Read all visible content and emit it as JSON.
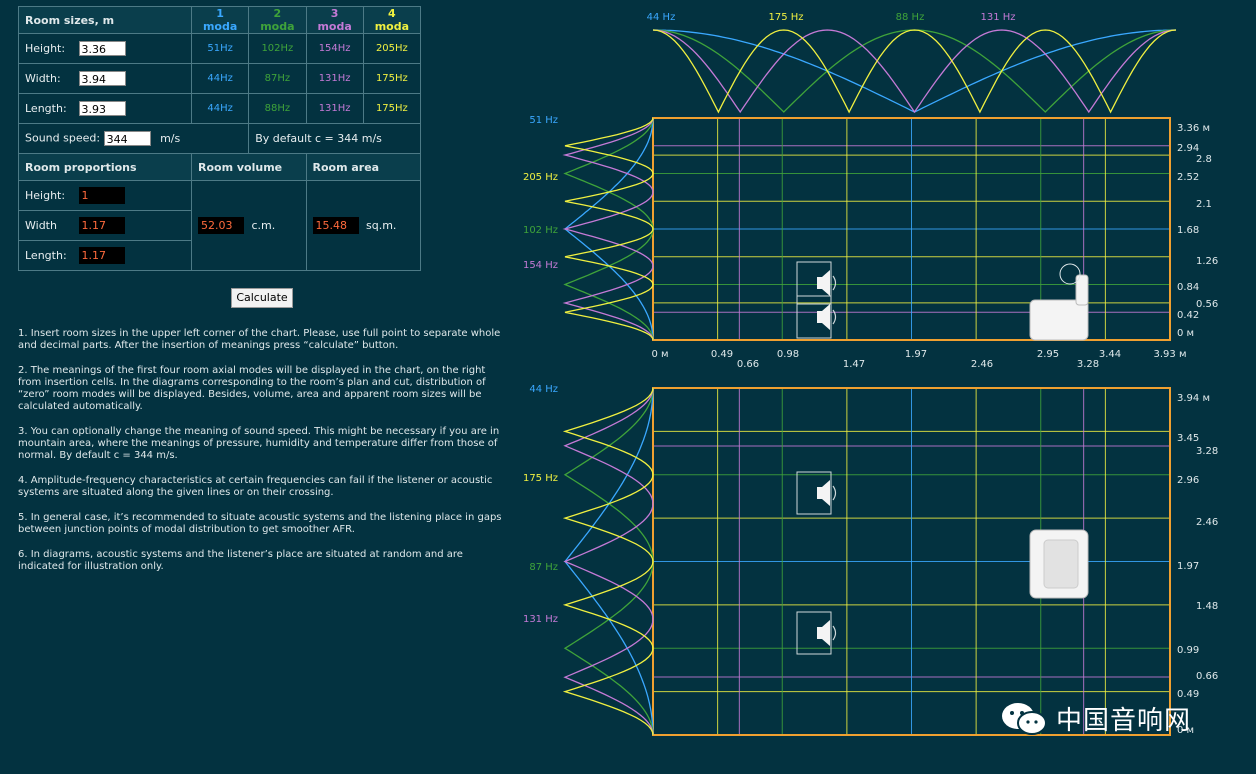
{
  "table": {
    "title": "Room sizes, m",
    "mode_headers": [
      "1 moda",
      "2 moda",
      "3 moda",
      "4 moda"
    ],
    "rows": [
      {
        "label": "Height:",
        "value": "3.36",
        "modes": [
          "51Hz",
          "102Hz",
          "154Hz",
          "205Hz"
        ]
      },
      {
        "label": "Width:",
        "value": "3.94",
        "modes": [
          "44Hz",
          "87Hz",
          "131Hz",
          "175Hz"
        ]
      },
      {
        "label": "Length:",
        "value": "3.93",
        "modes": [
          "44Hz",
          "88Hz",
          "131Hz",
          "175Hz"
        ]
      }
    ],
    "sound_speed_label": "Sound speed:",
    "sound_speed_value": "344",
    "sound_speed_unit": "m/s",
    "default_text": "By default c = 344 m/s",
    "proportions_header": "Room proportions",
    "volume_header": "Room volume",
    "area_header": "Room area",
    "proportions": [
      {
        "label": "Height:",
        "value": "1"
      },
      {
        "label": "Width",
        "value": "1.17"
      },
      {
        "label": "Length:",
        "value": "1.17"
      }
    ],
    "volume_value": "52.03",
    "volume_unit": "c.m.",
    "area_value": "15.48",
    "area_unit": "sq.m."
  },
  "calculate_label": "Calculate",
  "notes": [
    "1. Insert room sizes in the upper left corner of the chart. Please, use full point to separate whole and decimal parts. After the insertion of meanings press “calculate” button.",
    "2. The meanings of the first four room axial modes will be displayed in the chart, on the right from insertion cells. In the diagrams corresponding to the room’s plan and cut, distribution of “zero” room modes will be displayed. Besides, volume, area and apparent room sizes will be calculated automatically.",
    "3. You can optionally change the meaning of sound speed. This might be necessary if you are in mountain area, where the meanings of pressure, humidity and temperature differ from those of normal. By default c = 344 m/s.",
    "4. Amplitude-frequency characteristics at certain frequencies can fail if the listener or acoustic systems are situated along the given lines or on their crossing.",
    "5. In general case, it’s recommended to situate acoustic systems and the listening place in gaps between junction points of modal distribution to get smoother AFR.",
    "6. In diagrams, acoustic systems and the listener’s place are situated at random and are indicated for illustration only."
  ],
  "colors": {
    "m1": "#3aa8ff",
    "m2": "#3fa33a",
    "m3": "#c47ad6",
    "m4": "#f0f040",
    "frame": "#f0a030"
  },
  "top_chart": {
    "x_labels": [
      "44 Hz",
      "175 Hz",
      "88 Hz",
      "131 Hz"
    ],
    "left_labels": [
      "51 Hz",
      "205 Hz",
      "102 Hz",
      "154 Hz"
    ],
    "right_ticks": [
      "3.36 м",
      "2.94",
      "2.8",
      "2.52",
      "2.1",
      "1.68",
      "1.26",
      "0.84",
      "0.56",
      "0.42",
      "0 м"
    ],
    "bottom_ticks": [
      "0 м",
      "0.49",
      "0.66",
      "0.98",
      "1.47",
      "1.97",
      "2.46",
      "2.95",
      "3.28",
      "3.44",
      "3.93 м"
    ]
  },
  "bottom_chart": {
    "left_labels": [
      "44 Hz",
      "175 Hz",
      "87 Hz",
      "131 Hz"
    ],
    "right_ticks": [
      "3.94 м",
      "3.45",
      "3.28",
      "2.96",
      "2.46",
      "1.97",
      "1.48",
      "0.99",
      "0.66",
      "0.49",
      "0 м"
    ]
  },
  "watermark": "中国音响网",
  "icons": {
    "speaker": "speaker-icon",
    "armchair": "armchair-icon",
    "wechat": "wechat-icon"
  }
}
